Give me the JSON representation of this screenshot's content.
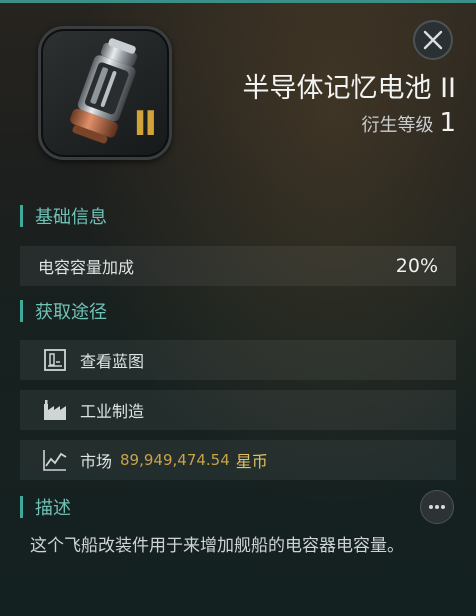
{
  "item": {
    "name": "半导体记忆电池 II",
    "tier_label": "衍生等级",
    "tier_value": "1",
    "tier_mark": "II",
    "icon": "capacitor-battery-icon"
  },
  "sections": {
    "basic_info_title": "基础信息",
    "acquire_title": "获取途径",
    "description_title": "描述"
  },
  "stats": [
    {
      "label": "电容容量加成",
      "value": "20%"
    }
  ],
  "sources": {
    "blueprint_label": "查看蓝图",
    "industry_label": "工业制造",
    "market_label": "市场",
    "market_price": "89,949,474.54",
    "market_currency": "星币"
  },
  "description": "这个飞船改装件用于来增加舰船的电容器电容量。",
  "icons": {
    "close": "close-icon",
    "blueprint": "blueprint-icon",
    "industry": "factory-icon",
    "market": "market-chart-icon",
    "more": "more-dots-icon"
  },
  "colors": {
    "accent": "#41a89c",
    "section_title": "#6ec2b6",
    "price": "#c9a24a",
    "tier_mark": "#d2a338"
  }
}
